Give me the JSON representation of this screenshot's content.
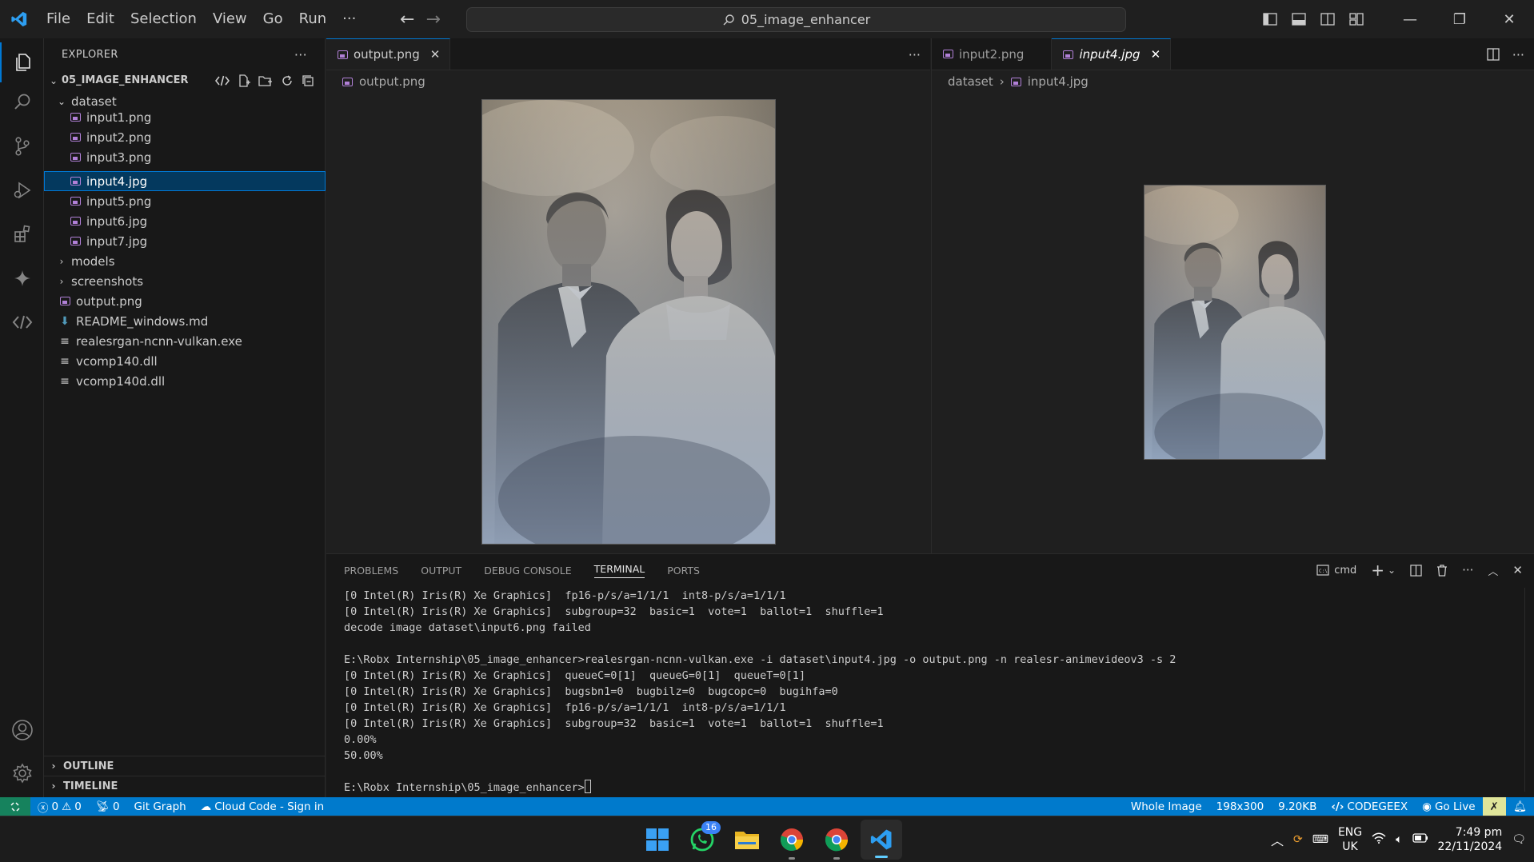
{
  "menu": [
    "File",
    "Edit",
    "Selection",
    "View",
    "Go",
    "Run",
    "···"
  ],
  "search": {
    "text": "05_image_enhancer"
  },
  "sidebar": {
    "title": "EXPLORER",
    "more": "···",
    "project": "05_IMAGE_ENHANCER",
    "tree": [
      {
        "label": "dataset",
        "type": "folder-open"
      },
      {
        "label": "input1.png",
        "type": "image"
      },
      {
        "label": "input2.png",
        "type": "image"
      },
      {
        "label": "input3.png",
        "type": "image"
      },
      {
        "label": "input4.jpg",
        "type": "image",
        "selected": true
      },
      {
        "label": "input5.png",
        "type": "image"
      },
      {
        "label": "input6.jpg",
        "type": "image"
      },
      {
        "label": "input7.jpg",
        "type": "image"
      },
      {
        "label": "models",
        "type": "folder"
      },
      {
        "label": "screenshots",
        "type": "folder"
      },
      {
        "label": "output.png",
        "type": "image"
      },
      {
        "label": "README_windows.md",
        "type": "markdown"
      },
      {
        "label": "realesrgan-ncnn-vulkan.exe",
        "type": "file"
      },
      {
        "label": "vcomp140.dll",
        "type": "file"
      },
      {
        "label": "vcomp140d.dll",
        "type": "file"
      }
    ],
    "outline": "OUTLINE",
    "timeline": "TIMELINE"
  },
  "editor_left": {
    "tab": "output.png",
    "breadcrumb": "output.png",
    "more": "···"
  },
  "editor_right": {
    "tabs": [
      "input2.png",
      "input4.jpg"
    ],
    "breadcrumb": [
      "dataset",
      "input4.jpg"
    ]
  },
  "panel": {
    "tabs": [
      "PROBLEMS",
      "OUTPUT",
      "DEBUG CONSOLE",
      "TERMINAL",
      "PORTS"
    ],
    "active_tab": "TERMINAL",
    "shell": "cmd",
    "lines": [
      "[0 Intel(R) Iris(R) Xe Graphics]  fp16-p/s/a=1/1/1  int8-p/s/a=1/1/1",
      "[0 Intel(R) Iris(R) Xe Graphics]  subgroup=32  basic=1  vote=1  ballot=1  shuffle=1",
      "decode image dataset\\input6.png failed",
      "",
      "E:\\Robx Internship\\05_image_enhancer>realesrgan-ncnn-vulkan.exe -i dataset\\input4.jpg -o output.png -n realesr-animevideov3 -s 2",
      "[0 Intel(R) Iris(R) Xe Graphics]  queueC=0[1]  queueG=0[1]  queueT=0[1]",
      "[0 Intel(R) Iris(R) Xe Graphics]  bugsbn1=0  bugbilz=0  bugcopc=0  bugihfa=0",
      "[0 Intel(R) Iris(R) Xe Graphics]  fp16-p/s/a=1/1/1  int8-p/s/a=1/1/1",
      "[0 Intel(R) Iris(R) Xe Graphics]  subgroup=32  basic=1  vote=1  ballot=1  shuffle=1",
      "0.00%",
      "50.00%",
      ""
    ],
    "prompt": "E:\\Robx Internship\\05_image_enhancer>"
  },
  "statusbar": {
    "problems": "0",
    "warnings": "0",
    "ports": "0",
    "git_graph": "Git Graph",
    "cloud_code": "Cloud Code - Sign in",
    "whole_image": "Whole Image",
    "dimensions": "198x300",
    "size": "9.20KB",
    "codegeex": "CODEGEEX",
    "go_live": "Go Live",
    "accent": "#007acc"
  },
  "taskbar": {
    "whatsapp_badge": "16",
    "lang_top": "ENG",
    "lang_bottom": "UK",
    "time": "7:49 pm",
    "date": "22/11/2024"
  }
}
